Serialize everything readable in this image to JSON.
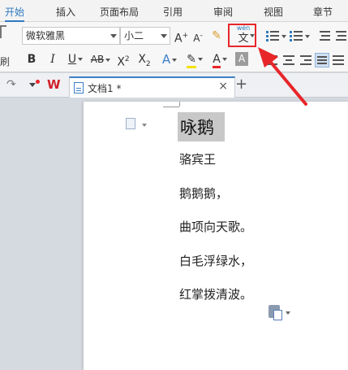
{
  "ribbon_tabs": [
    "开始",
    "插入",
    "页面布局",
    "引用",
    "审阅",
    "视图",
    "章节"
  ],
  "ribbon": {
    "clipboard_label": "刷",
    "font_name": "微软雅黑",
    "font_size": "小二",
    "grow_font": "A",
    "shrink_font": "A",
    "bold": "B",
    "italic": "I",
    "underline": "U",
    "strike": "AB",
    "superscript": "X",
    "subscript": "X",
    "font_effect": "A",
    "font_color": "A",
    "char_shading": "A",
    "phonetic_top": "wén",
    "phonetic_bottom": "文",
    "accent_color": "#e8262a",
    "active_tab_color": "#2f7ac3"
  },
  "docbar": {
    "doc_title": "文档1 *",
    "close": "×",
    "new_tab": "+"
  },
  "document": {
    "title": "咏鹅",
    "lines": [
      "骆宾王",
      "鹅鹅鹅，",
      "曲项向天歌。",
      "白毛浮绿水，",
      "红掌拨清波。"
    ]
  }
}
